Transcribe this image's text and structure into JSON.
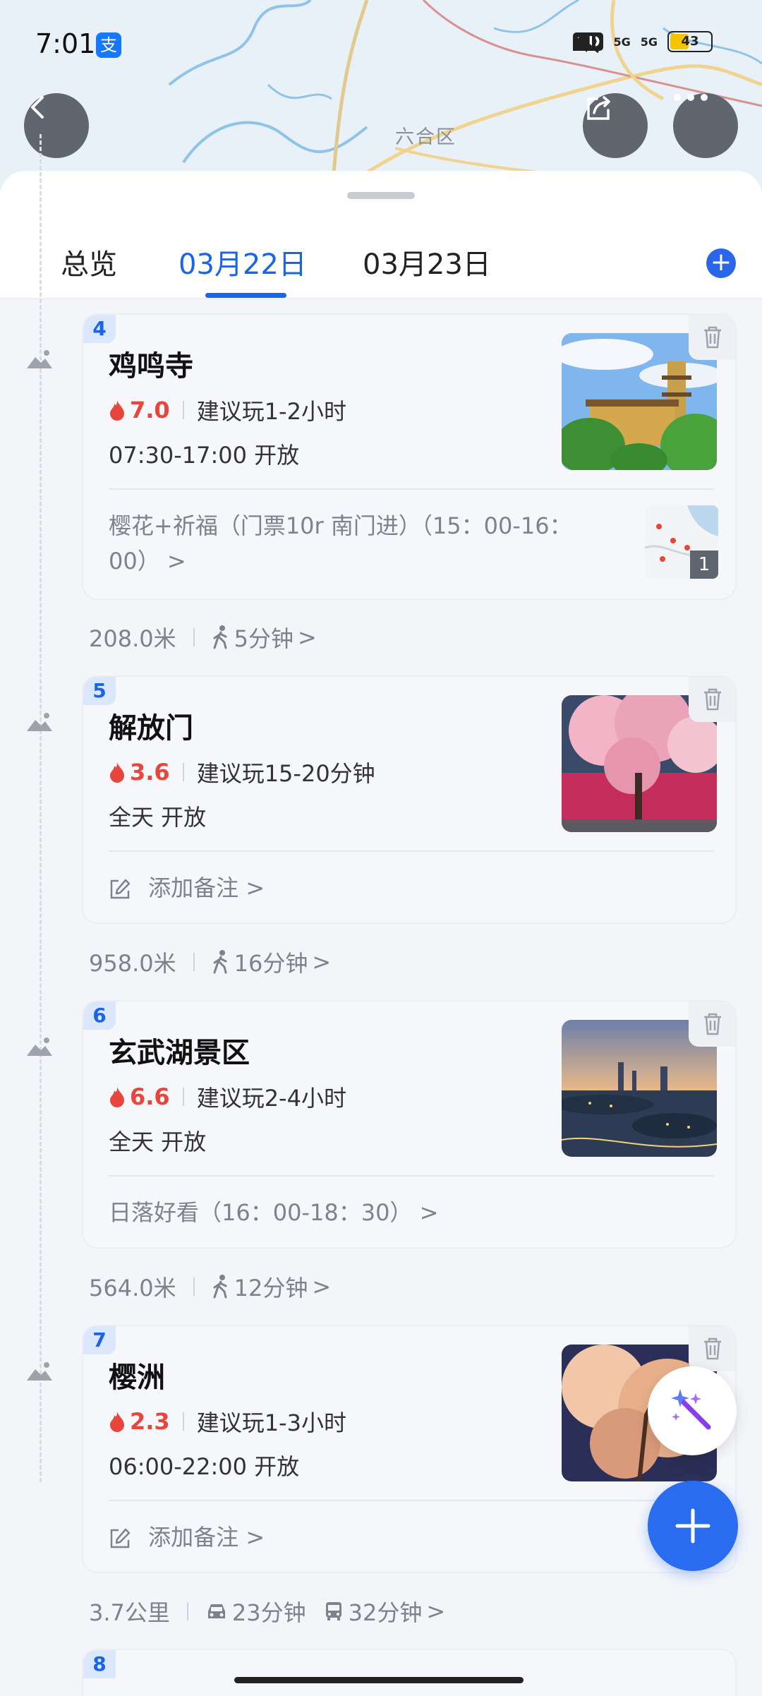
{
  "status_bar": {
    "time": "7:01",
    "alipay_badge": "支",
    "hd_label": "HD",
    "signal1": "5G",
    "signal2": "5G",
    "battery": "43"
  },
  "map": {
    "district_label": "六合区"
  },
  "tabs": [
    {
      "label": "总览",
      "active": false
    },
    {
      "label": "03月22日",
      "active": true
    },
    {
      "label": "03月23日",
      "active": false
    }
  ],
  "stops": [
    {
      "index": "4",
      "name": "鸡鸣寺",
      "heat": "7.0",
      "suggest": "建议玩1-2小时",
      "hours": "07:30-17:00 开放",
      "note": "樱花+祈福（门票10r 南门进）（15：00-16：00）",
      "note_arrow": ">",
      "note_image_count": "1"
    },
    {
      "index": "5",
      "name": "解放门",
      "heat": "3.6",
      "suggest": "建议玩15-20分钟",
      "hours": "全天 开放",
      "note": "添加备注",
      "note_arrow": ">"
    },
    {
      "index": "6",
      "name": "玄武湖景区",
      "heat": "6.6",
      "suggest": "建议玩2-4小时",
      "hours": "全天 开放",
      "note": "日落好看（16：00-18：30）",
      "note_arrow": ">"
    },
    {
      "index": "7",
      "name": "樱洲",
      "heat": "2.3",
      "suggest": "建议玩1-3小时",
      "hours": "06:00-22:00 开放",
      "note": "添加备注",
      "note_arrow": ">"
    }
  ],
  "routes": [
    {
      "distance": "208.0米",
      "walk": "5分钟",
      "arrow": ">"
    },
    {
      "distance": "958.0米",
      "walk": "16分钟",
      "arrow": ">"
    },
    {
      "distance": "564.0米",
      "walk": "12分钟",
      "arrow": ">"
    },
    {
      "distance": "3.7公里",
      "car": "23分钟",
      "bus": "32分钟",
      "arrow": ">"
    }
  ],
  "next_stop_index": "8",
  "colors": {
    "accent": "#1a64e8",
    "heat": "#e8453c",
    "fab": "#2a6cf0"
  }
}
